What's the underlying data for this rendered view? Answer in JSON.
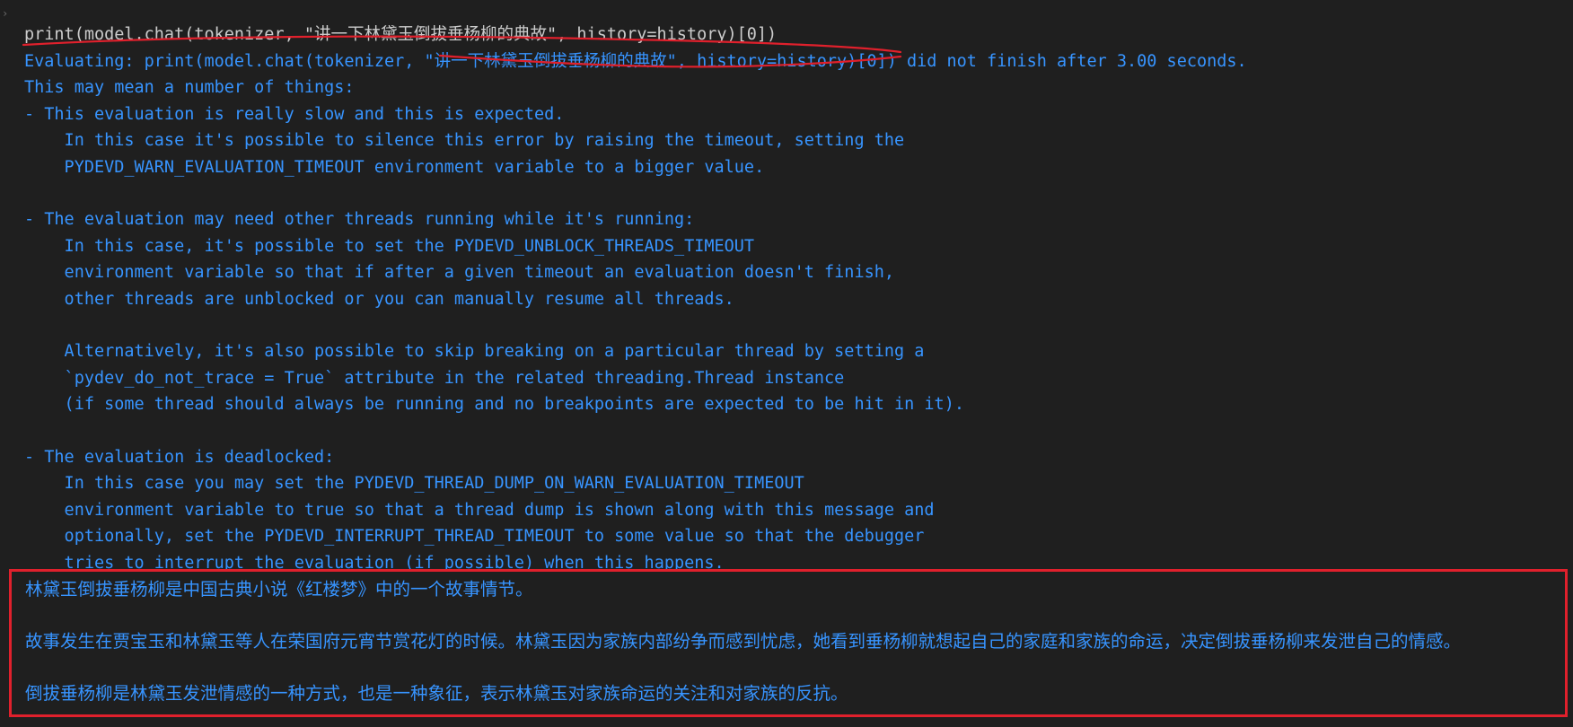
{
  "command": "print(model.chat(tokenizer, \"讲一下林黛玉倒拔垂杨柳的典故\", history=history)[0])",
  "warning_lines": [
    "Evaluating: print(model.chat(tokenizer, \"讲一下林黛玉倒拔垂杨柳的典故\", history=history)[0]) did not finish after 3.00 seconds.",
    "This may mean a number of things:",
    "- This evaluation is really slow and this is expected.",
    "    In this case it's possible to silence this error by raising the timeout, setting the",
    "    PYDEVD_WARN_EVALUATION_TIMEOUT environment variable to a bigger value.",
    "",
    "- The evaluation may need other threads running while it's running:",
    "    In this case, it's possible to set the PYDEVD_UNBLOCK_THREADS_TIMEOUT",
    "    environment variable so that if after a given timeout an evaluation doesn't finish,",
    "    other threads are unblocked or you can manually resume all threads.",
    "",
    "    Alternatively, it's also possible to skip breaking on a particular thread by setting a",
    "    `pydev_do_not_trace = True` attribute in the related threading.Thread instance",
    "    (if some thread should always be running and no breakpoints are expected to be hit in it).",
    "",
    "- The evaluation is deadlocked:",
    "    In this case you may set the PYDEVD_THREAD_DUMP_ON_WARN_EVALUATION_TIMEOUT",
    "    environment variable to true so that a thread dump is shown along with this message and",
    "    optionally, set the PYDEVD_INTERRUPT_THREAD_TIMEOUT to some value so that the debugger",
    "    tries to interrupt the evaluation (if possible) when this happens."
  ],
  "answer_lines": [
    "林黛玉倒拔垂杨柳是中国古典小说《红楼梦》中的一个故事情节。",
    "故事发生在贾宝玉和林黛玉等人在荣国府元宵节赏花灯的时候。林黛玉因为家族内部纷争而感到忧虑，她看到垂杨柳就想起自己的家庭和家族的命运，决定倒拔垂杨柳来发泄自己的情感。",
    "倒拔垂杨柳是林黛玉发泄情感的一种方式，也是一种象征，表示林黛玉对家族命运的关注和对家族的反抗。"
  ],
  "colors": {
    "background": "#1f1f1f",
    "command_text": "#cccccc",
    "output_text": "#3794ff",
    "annotation_red": "#e0202c"
  }
}
